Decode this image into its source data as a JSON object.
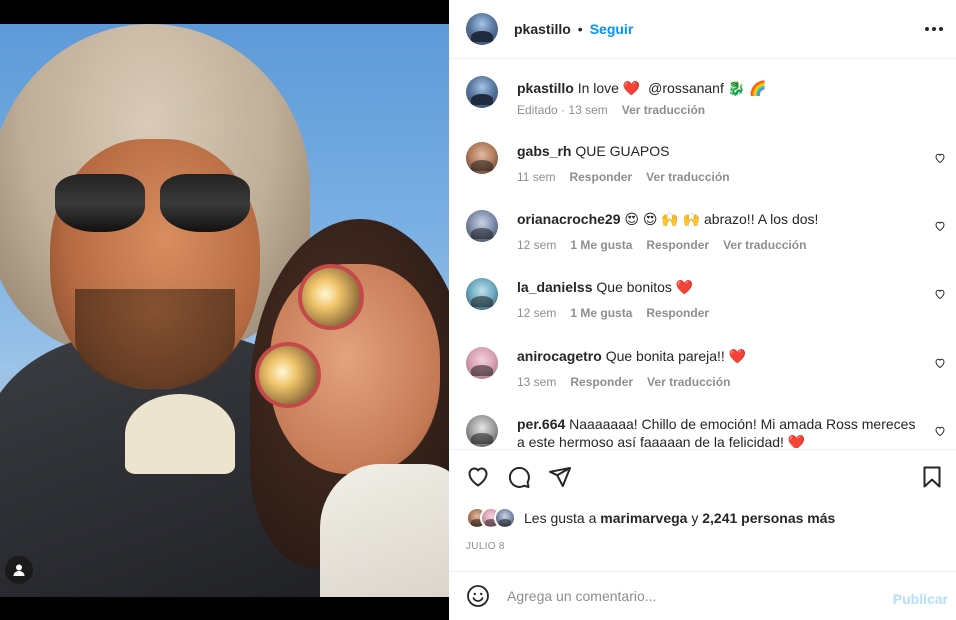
{
  "post": {
    "author": "pkastillo",
    "follow_label": "Seguir",
    "dot": "•",
    "caption": {
      "username": "pkastillo",
      "text": "In love",
      "heart": "❤️",
      "mention": "@rossananf",
      "emojis": "🐉 🌈",
      "edited": "Editado",
      "time": "13 sem",
      "translate": "Ver traducción"
    }
  },
  "comments": [
    {
      "username": "gabs_rh",
      "text": "QUE GUAPOS",
      "time": "11 sem",
      "likes": "",
      "reply": "Responder",
      "translate": "Ver traducción"
    },
    {
      "username": "orianacroche29",
      "text": "😍 😍 🙌 🙌 abrazo!! A los dos!",
      "time": "12 sem",
      "likes": "1 Me gusta",
      "reply": "Responder",
      "translate": "Ver traducción"
    },
    {
      "username": "la_danielss",
      "text": "Que bonitos ❤️",
      "time": "12 sem",
      "likes": "1 Me gusta",
      "reply": "Responder",
      "translate": ""
    },
    {
      "username": "anirocagetro",
      "text": "Que bonita pareja!! ❤️",
      "time": "13 sem",
      "likes": "",
      "reply": "Responder",
      "translate": "Ver traducción"
    },
    {
      "username": "per.664",
      "text": "Naaaaaaa! Chillo de emoción! Mi amada Ross mereces a este hermoso así faaaaan de la felicidad! ❤️",
      "time": "",
      "likes": "",
      "reply": "",
      "translate": ""
    }
  ],
  "likes": {
    "prefix": "Les gusta a",
    "user": "marimarvega",
    "conj": "y",
    "count": "2,241 personas más"
  },
  "date": "JULIO 8",
  "composer": {
    "placeholder": "Agrega un comentario...",
    "publish": "Publicar"
  },
  "icons": {
    "like": "heart-icon",
    "comment": "comment-icon",
    "share": "share-icon",
    "save": "bookmark-icon",
    "emoji": "emoji-icon",
    "more": "more-icon",
    "tagged_user": "user-icon"
  },
  "colors": {
    "link": "#0095f6",
    "publish_disabled": "#b2dffc",
    "muted": "#8e8e8e",
    "heart": "#e0245e"
  }
}
